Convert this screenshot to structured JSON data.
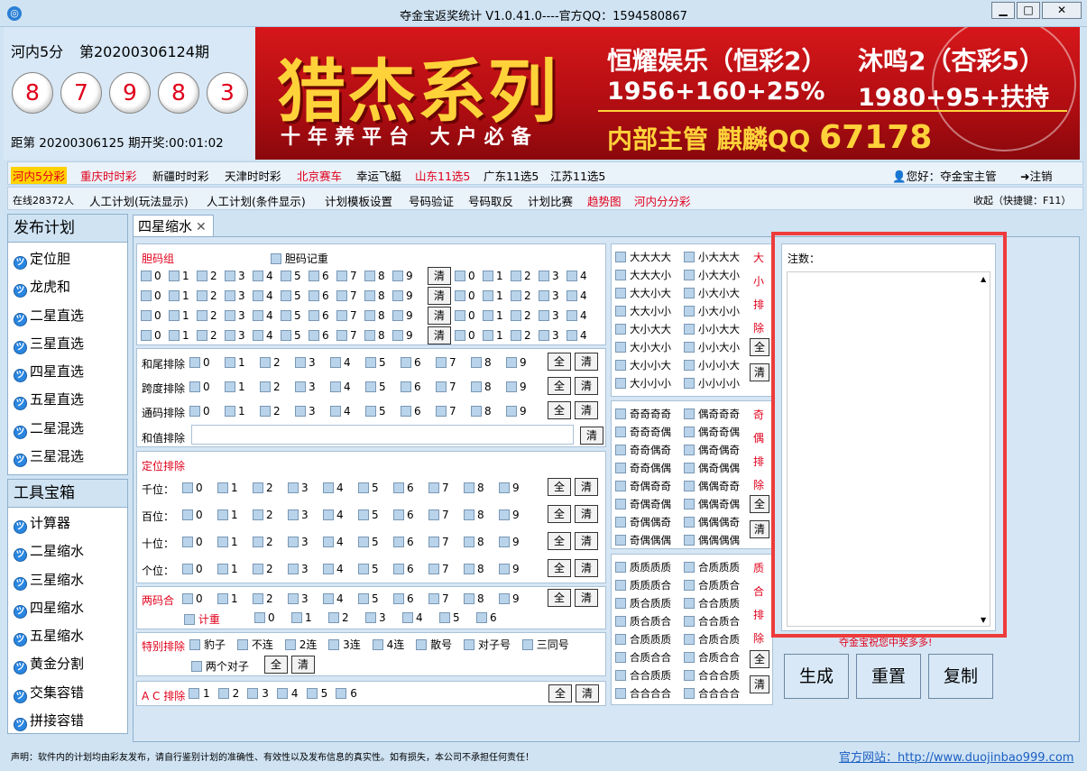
{
  "window": {
    "title": "夺金宝返奖统计  V1.0.41.0----官方QQ：1594580867",
    "minimize": "▁",
    "maximize": "□",
    "close": "✕"
  },
  "lottery": {
    "name": "河内5分",
    "period": "第20200306124期",
    "balls": [
      "8",
      "7",
      "9",
      "8",
      "3"
    ],
    "next_prefix": "距第",
    "next_period": "20200306125",
    "next_suffix": "期开奖:",
    "countdown": "00:01:02"
  },
  "banner": {
    "title": "猎杰系列",
    "slogan": "十年养平台  大户必备",
    "line1a": "恒耀娱乐（恒彩2）",
    "line1b": "沐鸣2（杏彩5）",
    "line2a": "1956+160+25%",
    "line2b": "1980+95+扶持",
    "line3": "内部主管 麒麟QQ",
    "qq": "67178"
  },
  "nav1": {
    "items": [
      "河内5分彩",
      "重庆时时彩",
      "新疆时时彩",
      "天津时时彩",
      "北京赛车",
      "幸运飞艇",
      "山东11选5",
      "广东11选5",
      "江苏11选5"
    ],
    "greeting": "您好：夺金宝主管",
    "logout": "注销"
  },
  "nav2": {
    "online": "在线28372人",
    "items": [
      "人工计划(玩法显示)",
      "人工计划(条件显示)",
      "计划模板设置",
      "号码验证",
      "号码取反",
      "计划比赛",
      "趋势图",
      "河内分分彩"
    ],
    "collapse": "收起（快捷键：F11）"
  },
  "sidebar": {
    "plan_header": "发布计划",
    "plan_items": [
      "定位胆",
      "龙虎和",
      "二星直选",
      "三星直选",
      "四星直选",
      "五星直选",
      "二星混选",
      "三星混选"
    ],
    "tool_header": "工具宝箱",
    "tool_items": [
      "计算器",
      "二星缩水",
      "三星缩水",
      "四星缩水",
      "五星缩水",
      "黄金分割",
      "交集容错",
      "拼接容错"
    ]
  },
  "tab": {
    "label": "四星缩水",
    "close": "✕"
  },
  "filters": {
    "dan_group": "胆码组",
    "dan_record": "胆码记重",
    "clear": "清",
    "all": "全",
    "hewei": "和尾排除",
    "kuadu": "跨度排除",
    "tongma": "通码排除",
    "hezhi": "和值排除",
    "dingwei": "定位排除",
    "qian": "千位：",
    "bai": "百位：",
    "shi": "十位：",
    "ge": "个位：",
    "liangma": "两码合",
    "jizhong": "计重",
    "teshu": "特别排除",
    "baozi": "豹子",
    "bulian": "不连",
    "lian2": "2连",
    "lian3": "3连",
    "lian4": "4连",
    "sanhao": "散号",
    "duizi": "对子号",
    "santong": "三同号",
    "liangdui": "两个对子",
    "ac": "A C 排除"
  },
  "daxiao": {
    "items": [
      "大大大大",
      "小大大大",
      "大大大小",
      "小大大小",
      "大大小大",
      "小大小大",
      "大大小小",
      "小大小小",
      "大小大大",
      "小小大大",
      "大小大小",
      "小小大小",
      "大小小大",
      "小小小大",
      "大小小小",
      "小小小小"
    ],
    "vert": [
      "大",
      "小",
      "排",
      "除"
    ]
  },
  "jiou": {
    "items": [
      "奇奇奇奇",
      "偶奇奇奇",
      "奇奇奇偶",
      "偶奇奇偶",
      "奇奇偶奇",
      "偶奇偶奇",
      "奇奇偶偶",
      "偶奇偶偶",
      "奇偶奇奇",
      "偶偶奇奇",
      "奇偶奇偶",
      "偶偶奇偶",
      "奇偶偶奇",
      "偶偶偶奇",
      "奇偶偶偶",
      "偶偶偶偶"
    ],
    "vert": [
      "奇",
      "偶",
      "排",
      "除"
    ]
  },
  "zhihe": {
    "items": [
      "质质质质",
      "合质质质",
      "质质质合",
      "合质质合",
      "质合质质",
      "合合质质",
      "质合质合",
      "合合质合",
      "合质质质",
      "合质合质",
      "合质合合",
      "合质合合",
      "合合质质",
      "合合合质",
      "合合合合",
      "合合合合"
    ],
    "vert": [
      "质",
      "合",
      "排",
      "除"
    ]
  },
  "result": {
    "label": "注数：",
    "wish": "夺金宝祝您中奖多多!",
    "generate": "生成",
    "reset": "重置",
    "copy": "复制"
  },
  "footer": {
    "disclaimer": "声明：软件内的计划均由彩友发布，请自行鉴别计划的准确性、有效性以及发布信息的真实性。如有损失，本公司不承担任何责任！",
    "site": "官方网站：http://www.duojinbao999.com"
  },
  "colors": {
    "accent_red": "#e0001b",
    "highlight": "#ffd200",
    "frame": "#ee3b3b"
  }
}
